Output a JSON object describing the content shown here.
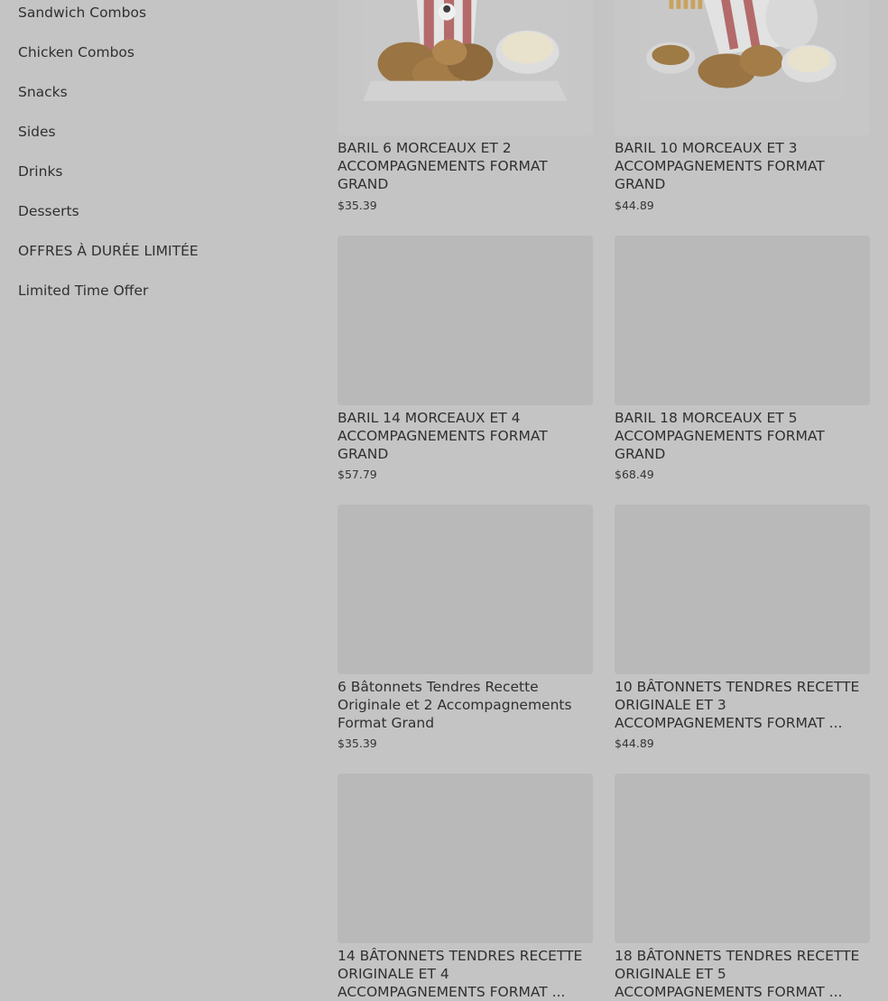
{
  "sidebar": {
    "items": [
      {
        "label": "Sandwich Combos"
      },
      {
        "label": "Chicken Combos"
      },
      {
        "label": "Snacks"
      },
      {
        "label": "Sides"
      },
      {
        "label": "Drinks"
      },
      {
        "label": "Desserts"
      },
      {
        "label": "OFFRES À DURÉE LIMITÉE"
      },
      {
        "label": "Limited Time Offer"
      }
    ]
  },
  "products": [
    {
      "title": "BARIL 6 MORCEAUX ET 2 ACCOMPAGNEMENTS FORMAT GRAND",
      "price": "$35.39",
      "image": "bucket-meal-photo"
    },
    {
      "title": "BARIL 10 MORCEAUX ET 3 ACCOMPAGNEMENTS FORMAT GRAND",
      "price": "$44.89",
      "image": "bucket-meal-photo"
    },
    {
      "title": "BARIL 14 MORCEAUX ET 4 ACCOMPAGNEMENTS FORMAT GRAND",
      "price": "$57.79",
      "image": "image-placeholder"
    },
    {
      "title": "BARIL 18 MORCEAUX ET 5 ACCOMPAGNEMENTS FORMAT GRAND",
      "price": "$68.49",
      "image": "image-placeholder"
    },
    {
      "title": "6 Bâtonnets Tendres Recette Originale et 2 Accompagnements Format Grand",
      "price": "$35.39",
      "image": "image-placeholder"
    },
    {
      "title": "10 BÂTONNETS TENDRES RECETTE ORIGINALE ET 3 ACCOMPAGNEMENTS FORMAT ...",
      "price": "$44.89",
      "image": "image-placeholder"
    },
    {
      "title": "14 BÂTONNETS TENDRES RECETTE ORIGINALE ET 4 ACCOMPAGNEMENTS FORMAT ...",
      "price": "",
      "image": "image-placeholder"
    },
    {
      "title": "18 BÂTONNETS TENDRES RECETTE ORIGINALE ET 5 ACCOMPAGNEMENTS FORMAT ...",
      "price": "",
      "image": "image-placeholder"
    }
  ]
}
